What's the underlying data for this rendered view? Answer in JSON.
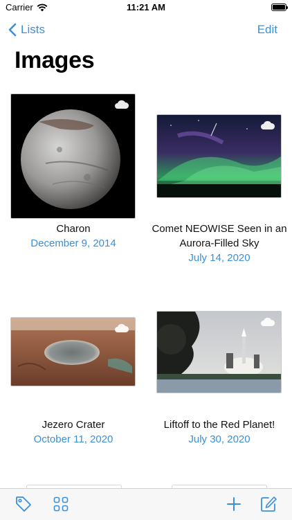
{
  "status_bar": {
    "carrier": "Carrier",
    "time": "11:21 AM"
  },
  "nav": {
    "back_label": "Lists",
    "edit_label": "Edit"
  },
  "page_title": "Images",
  "items": [
    {
      "title": "Charon",
      "date": "December 9, 2014"
    },
    {
      "title": "Comet NEOWISE Seen in an Aurora-Filled Sky",
      "date": "July 14, 2020"
    },
    {
      "title": "Jezero Crater",
      "date": "October 11, 2020"
    },
    {
      "title": "Liftoff to the Red Planet!",
      "date": "July 30, 2020"
    }
  ],
  "toolbar": {
    "icons": [
      "tag-icon",
      "grid-icon",
      "add-icon",
      "compose-icon"
    ]
  },
  "colors": {
    "accent": "#3a8fd9",
    "toolbar_bg": "#f7f7f7"
  }
}
